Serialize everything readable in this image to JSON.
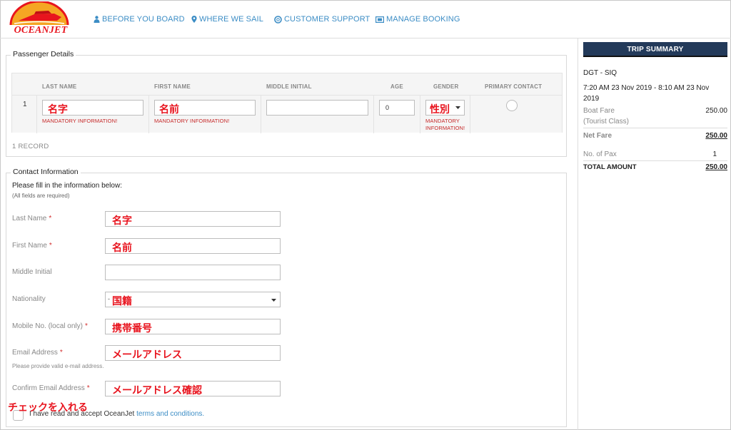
{
  "brand": {
    "name": "OCEANJET"
  },
  "nav": [
    {
      "label": "BEFORE YOU BOARD",
      "icon": "person-icon"
    },
    {
      "label": "WHERE WE SAIL",
      "icon": "map-pin-icon"
    },
    {
      "label": "CUSTOMER SUPPORT",
      "icon": "life-ring-icon"
    },
    {
      "label": "MANAGE BOOKING",
      "icon": "ticket-icon"
    }
  ],
  "passenger": {
    "legend": "Passenger Details",
    "columns": [
      "LAST NAME",
      "FIRST NAME",
      "MIDDLE INITIAL",
      "AGE",
      "GENDER",
      "PRIMARY CONTACT"
    ],
    "row": {
      "index": "1",
      "last_name_note": "名字",
      "first_name_note": "名前",
      "age": "0",
      "gender_note": "性別",
      "mandatory_last": "MANDATORY INFORMATION!",
      "mandatory_first": "MANDATORY INFORMATION!",
      "mandatory_gender_1": "MANDATORY",
      "mandatory_gender_2": "INFORMATION!"
    },
    "record_count": "1 RECORD"
  },
  "contact": {
    "legend": "Contact Information",
    "intro": "Please fill in the information below:",
    "subintro": "(All fields are required)",
    "fields": {
      "last_name": {
        "label": "Last Name",
        "note": "名字"
      },
      "first_name": {
        "label": "First Name",
        "note": "名前"
      },
      "middle_initial": {
        "label": "Middle Initial"
      },
      "nationality": {
        "label": "Nationality",
        "note": "国籍",
        "prefix": "-"
      },
      "mobile": {
        "label": "Mobile No. (local only)",
        "note": "携帯番号"
      },
      "email": {
        "label": "Email Address",
        "note": "メールアドレス",
        "hint": "Please provide valid e-mail address."
      },
      "confirm_email": {
        "label": "Confirm Email Address",
        "note": "メールアドレス確認"
      }
    },
    "required_mark": "*",
    "terms_note": "チェックを入れる",
    "terms_text": "I have read and accept OceanJet",
    "terms_link": "terms and conditions."
  },
  "summary": {
    "title": "TRIP SUMMARY",
    "route": "DGT - SIQ",
    "schedule_1": "7:20 AM 23 Nov 2019 - 8:10 AM 23 Nov",
    "schedule_2": "2019",
    "boat_fare_label": "Boat Fare",
    "boat_fare_class": "(Tourist Class)",
    "boat_fare": "250.00",
    "net_fare_label": "Net Fare",
    "net_fare": "250.00",
    "pax_label": "No. of Pax",
    "pax": "1",
    "total_label": "TOTAL AMOUNT",
    "total": "250.00"
  },
  "colors": {
    "accent": "#3c8dc5",
    "annotation": "#e8141e",
    "header_bar": "#233a5a"
  }
}
